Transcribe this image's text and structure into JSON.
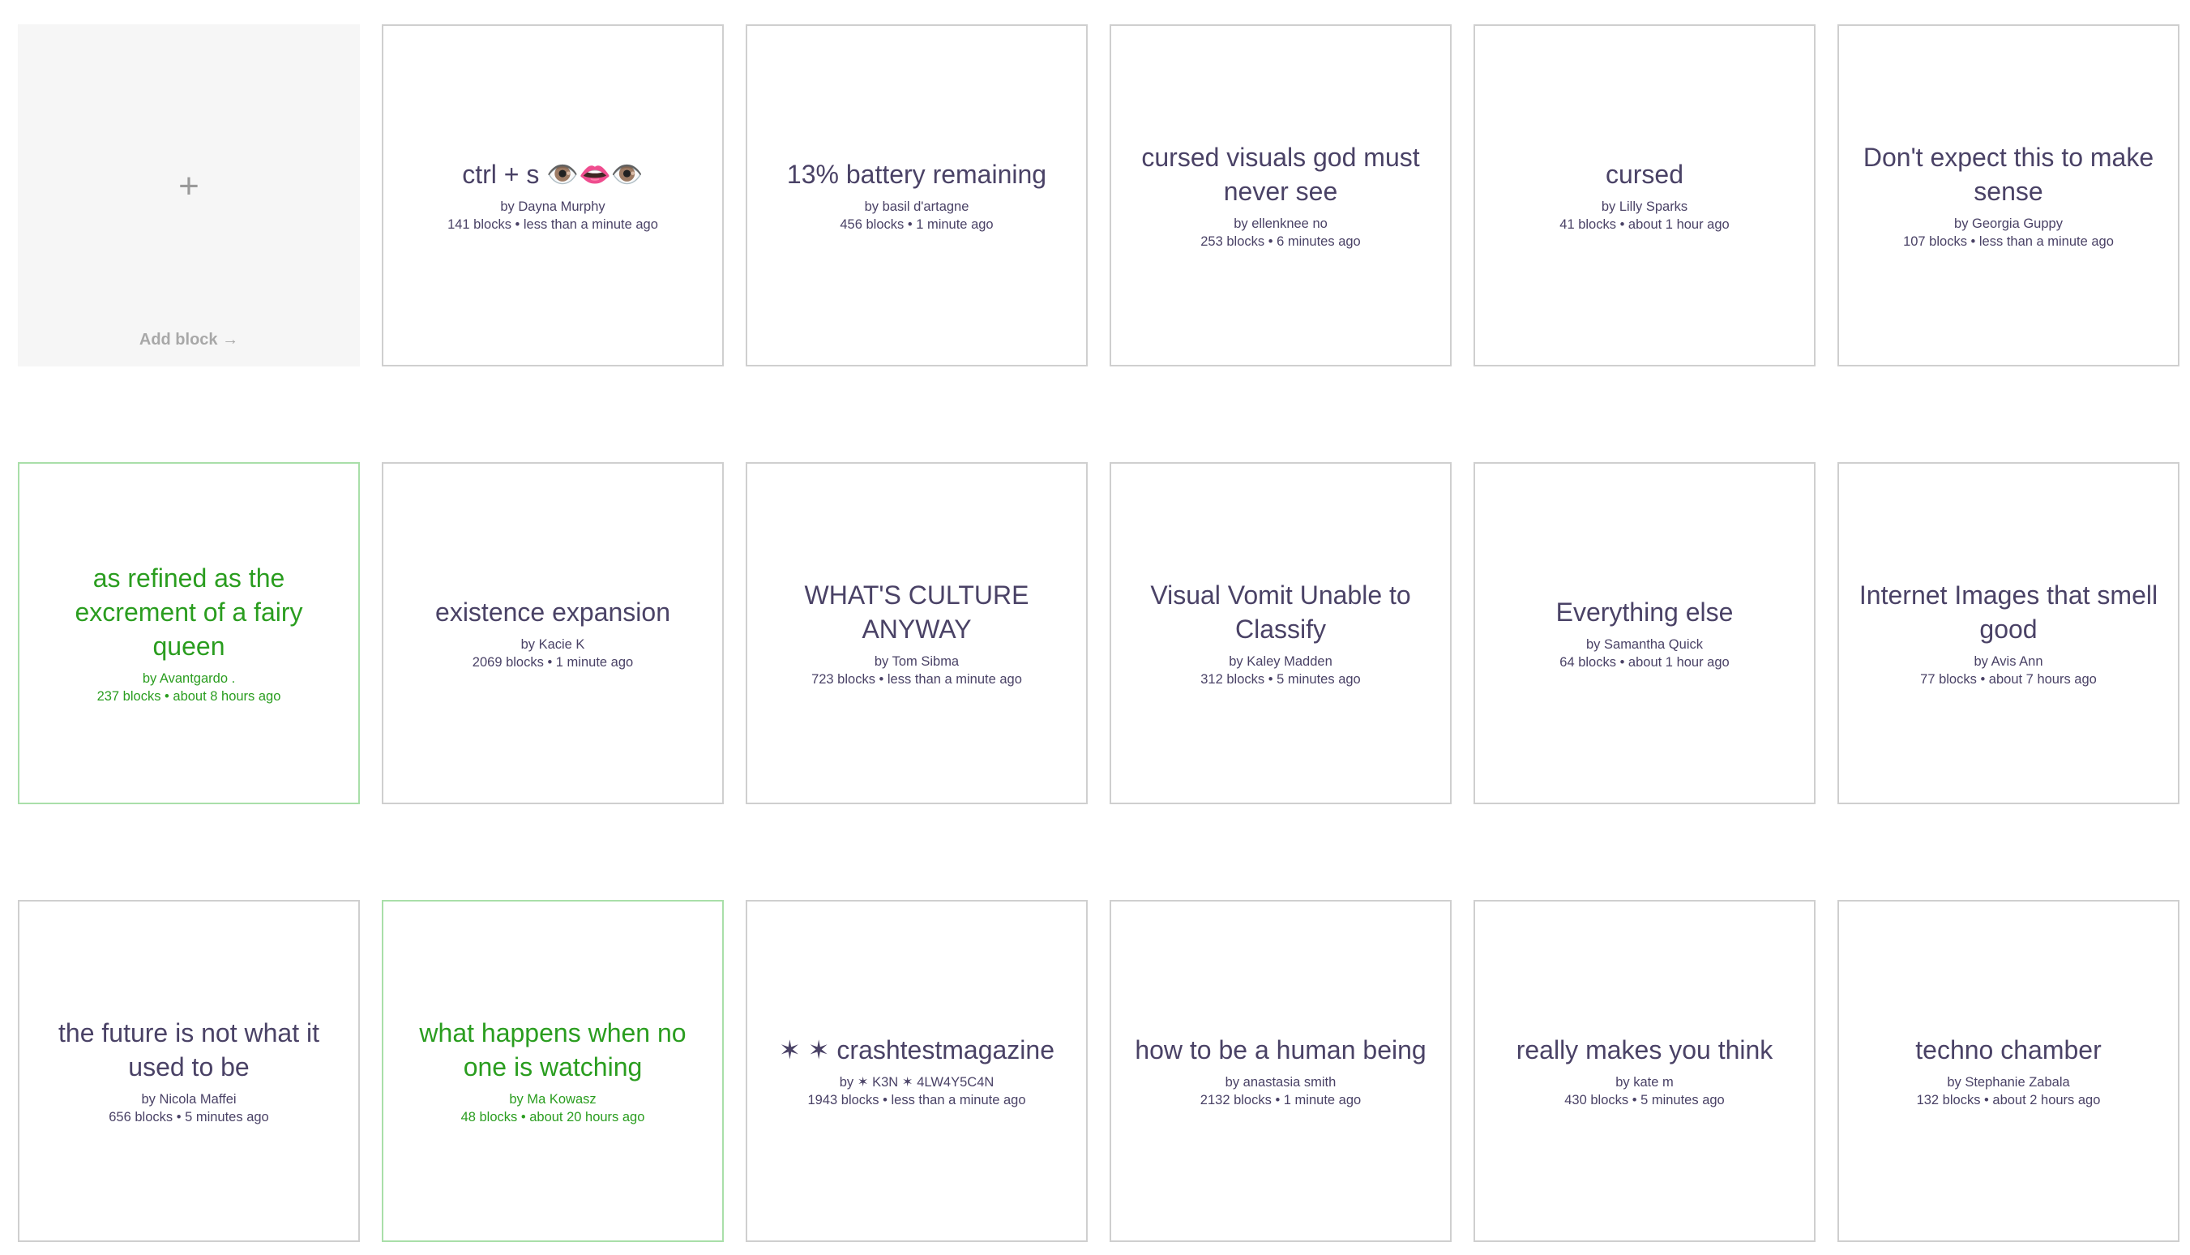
{
  "add_block": {
    "plus": "+",
    "label": "Add block",
    "arrow": "→"
  },
  "channels": [
    {
      "title": "ctrl + s 👁️👄👁️",
      "author": "by Dayna Murphy",
      "meta": "141 blocks • less than a minute ago",
      "color": "default"
    },
    {
      "title": "13% battery remaining",
      "author": "by basil d'artagne",
      "meta": "456 blocks • 1 minute ago",
      "color": "default"
    },
    {
      "title": "cursed visuals god must never see",
      "author": "by ellenknee no",
      "meta": "253 blocks • 6 minutes ago",
      "color": "default"
    },
    {
      "title": "cursed",
      "author": "by Lilly Sparks",
      "meta": "41 blocks • about 1 hour ago",
      "color": "default"
    },
    {
      "title": "Don't expect this to make sense",
      "author": "by Georgia Guppy",
      "meta": "107 blocks • less than a minute ago",
      "color": "default"
    },
    {
      "title": "as refined as the excrement of a fairy queen",
      "author": "by Avantgardo .",
      "meta": "237 blocks • about 8 hours ago",
      "color": "green"
    },
    {
      "title": "existence expansion",
      "author": "by Kacie K",
      "meta": "2069 blocks • 1 minute ago",
      "color": "default"
    },
    {
      "title": "WHAT'S CULTURE ANYWAY",
      "author": "by Tom Sibma",
      "meta": "723 blocks • less than a minute ago",
      "color": "default"
    },
    {
      "title": "Visual Vomit Unable to Classify",
      "author": "by Kaley Madden",
      "meta": "312 blocks • 5 minutes ago",
      "color": "default"
    },
    {
      "title": "Everything else",
      "author": "by Samantha Quick",
      "meta": "64 blocks • about 1 hour ago",
      "color": "default"
    },
    {
      "title": "Internet Images that smell good",
      "author": "by Avis Ann",
      "meta": "77 blocks • about 7 hours ago",
      "color": "default"
    },
    {
      "title": "the future is not what it used to be",
      "author": "by Nicola Maffei",
      "meta": "656 blocks • 5 minutes ago",
      "color": "default"
    },
    {
      "title": "what happens when no one is watching",
      "author": "by Ma Kowasz",
      "meta": "48 blocks • about 20 hours ago",
      "color": "green"
    },
    {
      "title": "✶ ✶ crashtestmagazine",
      "author": "by ✶ K3N ✶ 4LW4Y5C4N",
      "meta": "1943 blocks • less than a minute ago",
      "color": "default"
    },
    {
      "title": "how to be a human being",
      "author": "by anastasia smith",
      "meta": "2132 blocks • 1 minute ago",
      "color": "default"
    },
    {
      "title": "really makes you think",
      "author": "by kate m",
      "meta": "430 blocks • 5 minutes ago",
      "color": "default"
    },
    {
      "title": "techno chamber",
      "author": "by Stephanie Zabala",
      "meta": "132 blocks • about 2 hours ago",
      "color": "default"
    }
  ],
  "colors": {
    "default_text": "#4a4266",
    "green_text": "#2a9d1f",
    "default_border": "#cfcfcf",
    "green_border": "#a9dfa9",
    "add_background": "#f6f6f6"
  }
}
